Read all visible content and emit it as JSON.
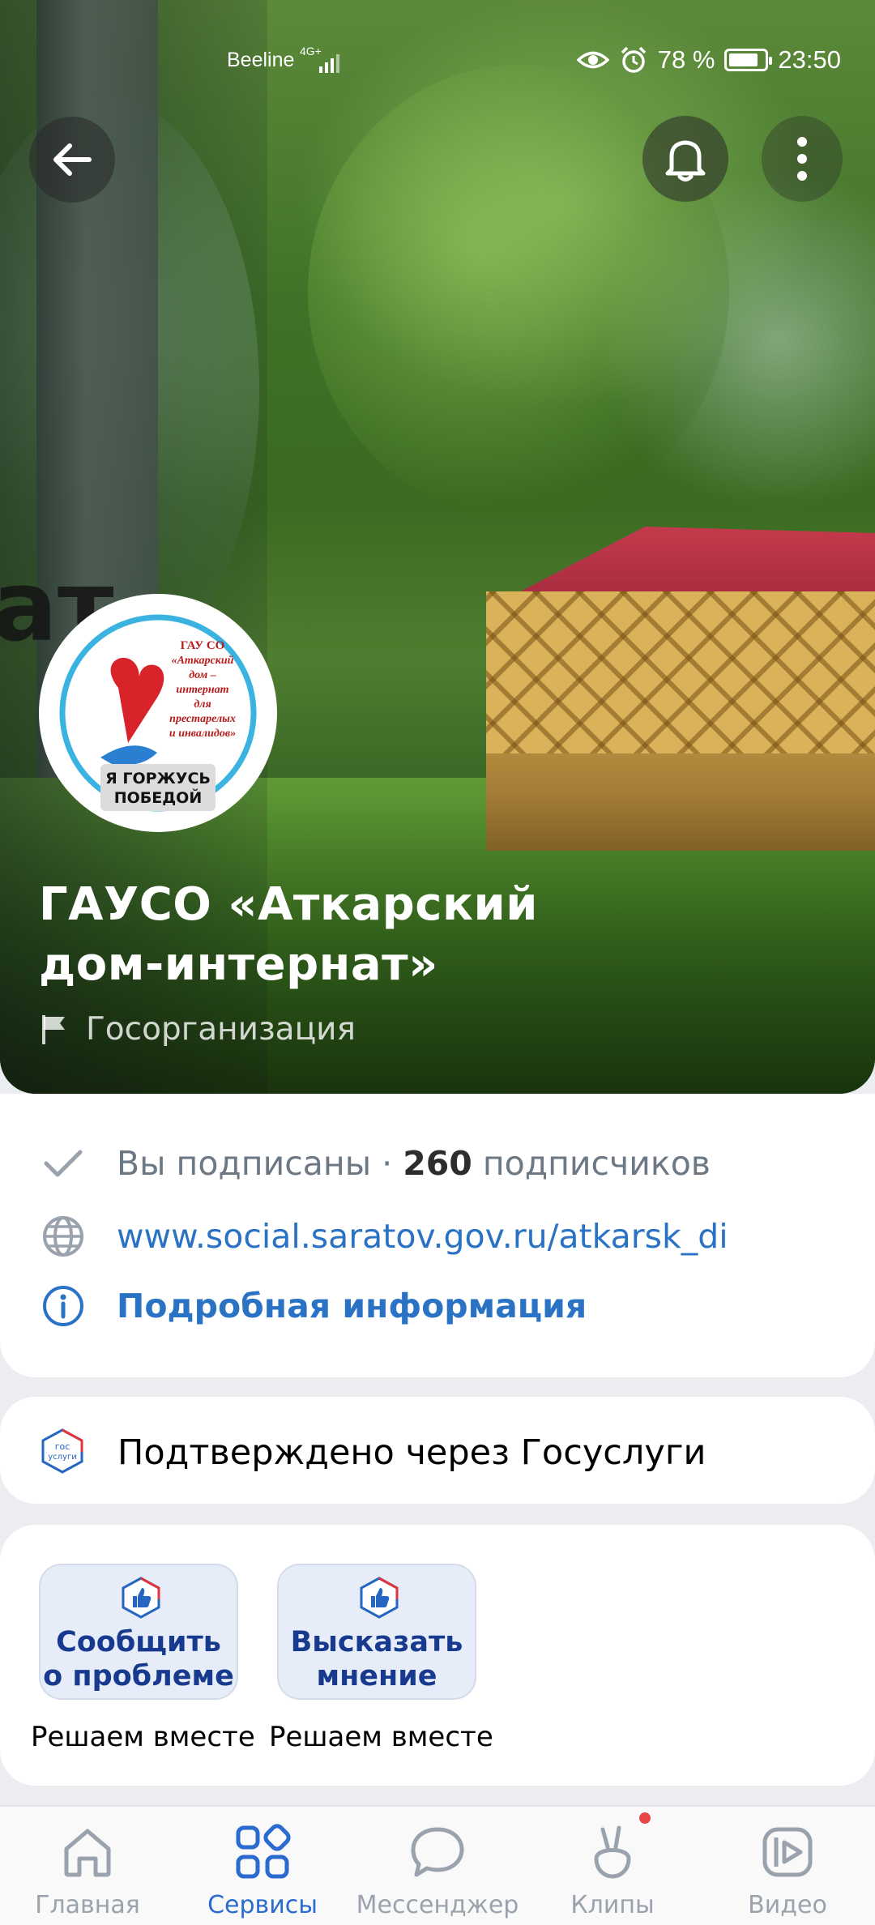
{
  "status_bar": {
    "carrier": "Beeline",
    "network": "4G+",
    "battery": "78 %",
    "time": "23:50"
  },
  "header": {
    "back_icon": "arrow-left-icon",
    "bell_icon": "bell-icon",
    "more_icon": "more-vertical-icon"
  },
  "cover": {
    "bg_text": "ат"
  },
  "avatar": {
    "line1": "ГАУ СО",
    "line2": "«Аткарский",
    "line3": "дом –",
    "line4": "интернат",
    "line5": "для",
    "line6": "престарелых",
    "line7": "и инвалидов»",
    "banner1": "Я ГОРЖУСЬ",
    "banner2": "ПОБЕДОЙ"
  },
  "page": {
    "title_line1": "ГАУСО «Аткарский",
    "title_line2": "дом-интернат»",
    "org_type": "Госорганизация"
  },
  "info": {
    "subscribed": "Вы подписаны ·",
    "subscribers_count": "260",
    "subscribers_label": "подписчиков",
    "website": "www.social.saratov.gov.ru/atkarsk_di",
    "details": "Подробная информация"
  },
  "gosuslugi": {
    "icon_text_1": "гос",
    "icon_text_2": "услуги",
    "text": "Подтверждено через Госуслуги"
  },
  "actions": [
    {
      "line1": "Сообщить",
      "line2": "о проблеме",
      "caption": "Решаем вместе"
    },
    {
      "line1": "Высказать",
      "line2": "мнение",
      "caption": "Решаем вместе"
    }
  ],
  "bottom_nav": [
    {
      "label": "Главная",
      "icon": "home-icon",
      "active": false
    },
    {
      "label": "Сервисы",
      "icon": "services-icon",
      "active": true
    },
    {
      "label": "Мессенджер",
      "icon": "messenger-icon",
      "active": false
    },
    {
      "label": "Клипы",
      "icon": "clips-icon",
      "active": false,
      "has_badge": true
    },
    {
      "label": "Видео",
      "icon": "video-icon",
      "active": false
    }
  ],
  "colors": {
    "accent": "#2a6bcf",
    "link": "#2a72c4",
    "badge": "#e64646",
    "action_text": "#173a8f"
  }
}
